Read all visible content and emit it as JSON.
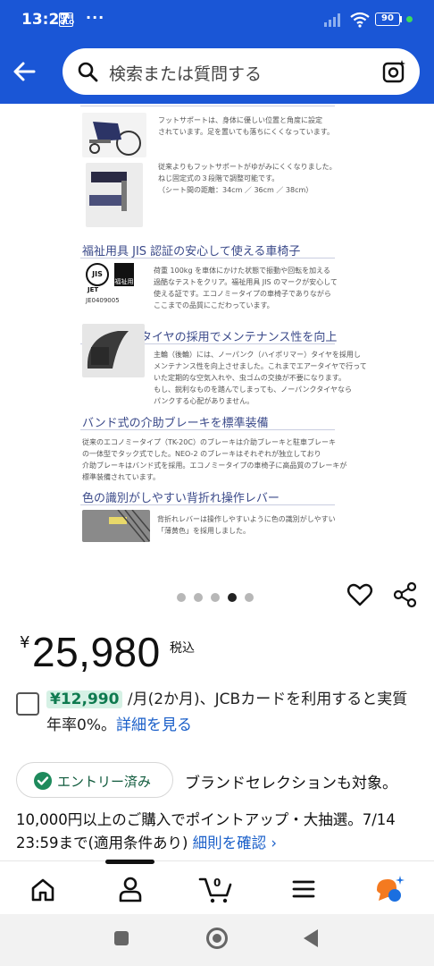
{
  "status_bar": {
    "time": "13:27",
    "uniqlo_icon": "UNI QLO",
    "more": "···",
    "battery": "90"
  },
  "header": {
    "search_placeholder": "検索または質問する",
    "brand_color": "#1a56d6"
  },
  "product_image": {
    "sections": [
      {
        "title": "",
        "caption_lines": [
          "フットサポートは、身体に優しい位置と角度に設定",
          "されています。足を置いても落ちにくくなっています。"
        ]
      },
      {
        "title": "",
        "caption_lines": [
          "従来よりもフットサポートがゆがみにくくなりました。",
          "ねじ固定式の３段階で調整可能です。",
          "（シート間の距離：34cm ／ 36cm ／ 38cm）"
        ]
      },
      {
        "title": "福祉用具 JIS 認証の安心して使える車椅子",
        "jis_mark": "JIS",
        "jet_label": "JET",
        "welfare_label": "福祉用具",
        "cert_number": "JE0409005",
        "caption_lines": [
          "荷重 100kg を車体にかけた状態で振動や回転を加える",
          "過酷なテストをクリア。福祉用具 JIS のマークが安心して",
          "使える証です。エコノミータイプの車椅子でありながら",
          "ここまでの品質にこだわっています。"
        ]
      },
      {
        "title": "ノーパンクタイヤの採用でメンテナンス性を向上",
        "caption_lines": [
          "主輪（後輪）には、ノーパンク（ハイポリマー）タイヤを採用し",
          "メンテナンス性を向上させました。これまでエアータイヤで行って",
          "いた定期的な空気入れや、虫ゴムの交換が不要になります。",
          "もし、鋭利なものを踏んでしまっても、ノーパンクタイヤなら",
          "パンクする心配がありません。"
        ]
      },
      {
        "title": "バンド式の介助ブレーキを標準装備",
        "caption_lines": [
          "従来のエコノミータイプ（TK-20C）のブレーキは介助ブレーキと駐車ブレーキ",
          "の一体型でタック式でした。NEO-2 のブレーキはそれぞれが独立しており",
          "介助ブレーキはバンド式を採用。エコノミータイプの車椅子に高品質のブレーキが",
          "標準装備されています。"
        ]
      },
      {
        "title": "色の識別がしやすい背折れ操作レバー",
        "caption_lines": [
          "背折れレバーは操作しやすいように色の識別がしやすい",
          "「薄黄色」を採用しました。"
        ]
      }
    ]
  },
  "carousel": {
    "count": 5,
    "active_index": 3
  },
  "price": {
    "yen_symbol": "¥",
    "value": "25,980",
    "tax_label": "税込"
  },
  "installment": {
    "amount": "¥12,990",
    "text": " /月(2か月)、JCBカードを利用すると実質年率0%。",
    "link": "詳細を見る"
  },
  "entry_badge": {
    "label": "エントリー済み",
    "accent": "#1e8a5c"
  },
  "brand_selection_text": "ブランドセレクションも対象。",
  "promo": {
    "text": "10,000円以上のご購入でポイントアップ・大抽選。7/14 23:59まで(適用条件あり) ",
    "link": "細則を確認",
    "link_chevron": "›"
  },
  "tabbar": {
    "active_index": 1,
    "cart_count": "0",
    "tabs": [
      "home-icon",
      "account-icon",
      "cart-icon",
      "menu-icon",
      "ai-assistant-icon"
    ]
  }
}
